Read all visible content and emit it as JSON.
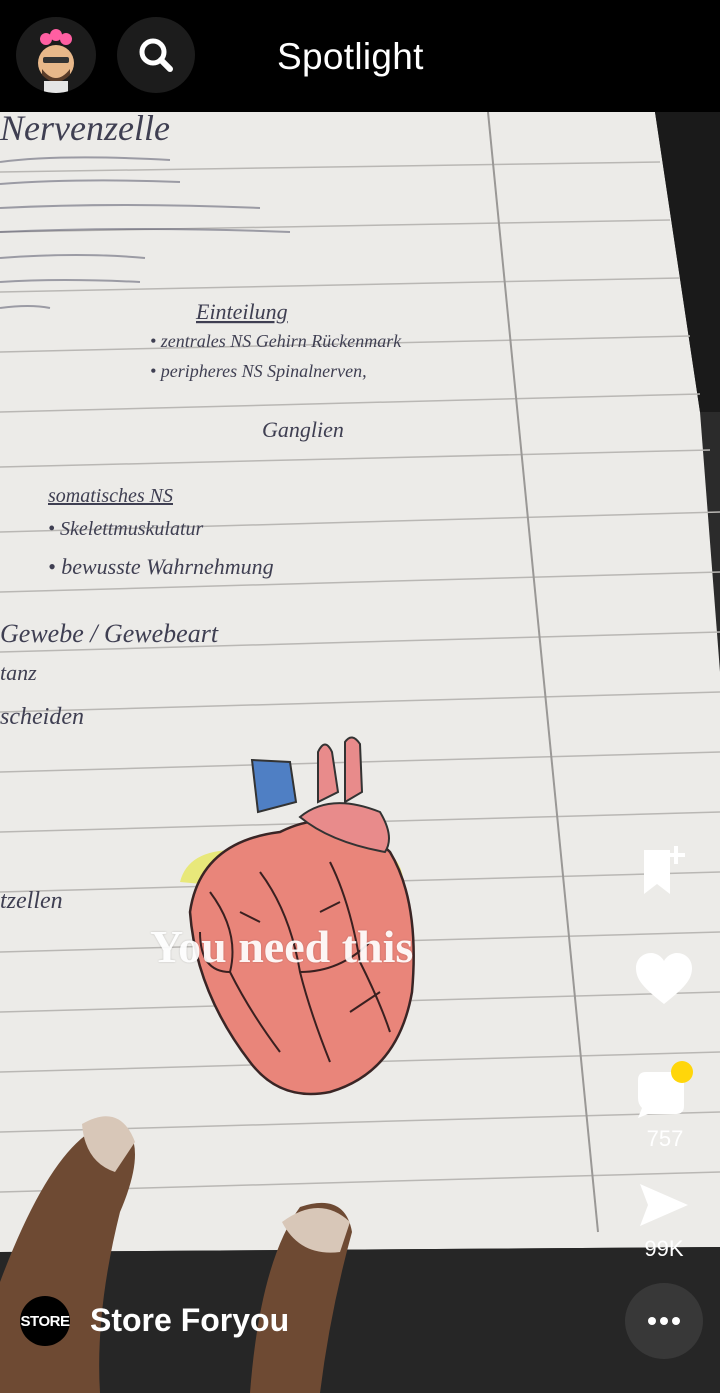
{
  "header": {
    "title": "Spotlight"
  },
  "video": {
    "overlay_caption": "You need this",
    "notebook_lines": [
      "Nervenzelle",
      "Einteilung",
      "• zentrales NS Gehirn Rückenmark",
      "• peripheres NS Spinalnerven,",
      "Ganglien",
      "somatisches NS",
      "• Skelettmuskulatur",
      "• bewusste Wahrnehmung",
      "Gewebe / Gewebeart",
      "tanz",
      "scheiden",
      "tzellen"
    ]
  },
  "actions": {
    "comment_count": "757",
    "share_count": "99K"
  },
  "creator": {
    "avatar_text": "STORE",
    "name": "Store Foryou"
  },
  "colors": {
    "background": "#000000",
    "white": "#ffffff",
    "notification_dot": "#FFD60A"
  }
}
